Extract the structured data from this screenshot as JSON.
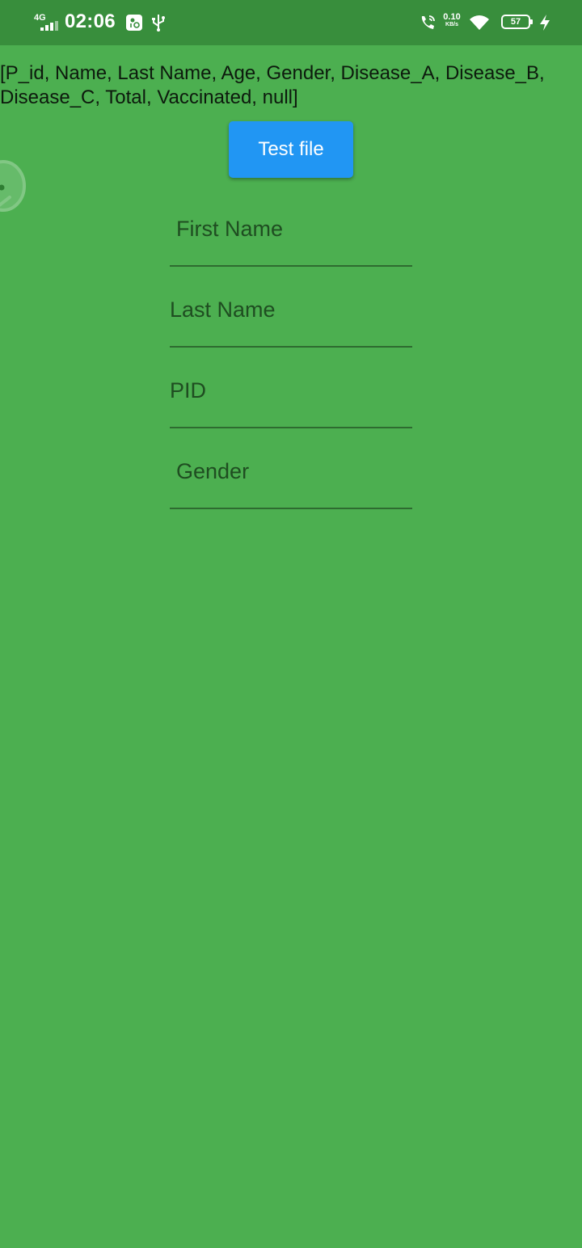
{
  "status_bar": {
    "network": "4G",
    "time": "02:06",
    "speed_value": "0.10",
    "speed_unit": "KB/s",
    "battery": "57"
  },
  "main": {
    "csv_header": "[P_id, Name, Last Name, Age, Gender, Disease_A, Disease_B, Disease_C, Total, Vaccinated, null]",
    "test_button_label": "Test file"
  },
  "form": {
    "first_name_placeholder": "First Name",
    "last_name_placeholder": "Last Name",
    "pid_placeholder": "PID",
    "gender_placeholder": "Gender"
  },
  "colors": {
    "background": "#4caf50",
    "status_bar": "#388e3c",
    "button": "#2196f3",
    "underline": "#2e6b30"
  }
}
